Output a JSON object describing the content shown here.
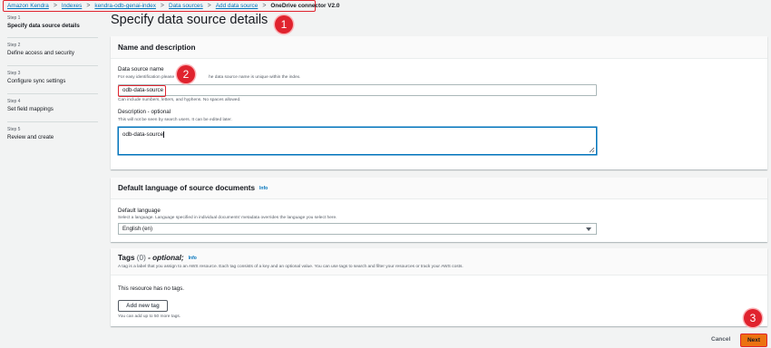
{
  "breadcrumb": {
    "items": [
      "Amazon Kendra",
      "Indexes",
      "kendra-odb-genai-index",
      "Data sources",
      "Add data source"
    ],
    "current": "OneDrive connector V2.0",
    "separator": ">"
  },
  "page_title": "Specify data source details",
  "steps": [
    {
      "num": "Step 1",
      "label": "Specify data source details",
      "active": true
    },
    {
      "num": "Step 2",
      "label": "Define access and security",
      "active": false
    },
    {
      "num": "Step 3",
      "label": "Configure sync settings",
      "active": false
    },
    {
      "num": "Step 4",
      "label": "Set field mappings",
      "active": false
    },
    {
      "num": "Step 5",
      "label": "Review and create",
      "active": false
    }
  ],
  "name_section": {
    "title": "Name and description",
    "name_label": "Data source name",
    "name_desc_start": "For easy identification please",
    "name_desc_end": "he data source name is unique within the index.",
    "name_value": "odb-data-source",
    "name_constraint": "Can include numbers, letters, and hyphens. No spaces allowed.",
    "desc_label": "Description - optional",
    "desc_help": "This will not be seen by search users. It can be edited later.",
    "desc_value": "odb-data-source"
  },
  "language_section": {
    "title": "Default language of source documents",
    "info": "Info",
    "label": "Default language",
    "desc": "Select a language. Language specified in individual documents' metadata overrides the language you select here.",
    "selected": "English (en)"
  },
  "tags_section": {
    "title_prefix": "Tags",
    "count": "(0)",
    "title_suffix": "- optional;",
    "info": "Info",
    "desc": "A tag is a label that you assign to an AWS resource. Each tag consists of a key and an optional value. You can use tags to search and filter your resources or track your AWS costs.",
    "empty": "This resource has no tags.",
    "add_button": "Add new tag",
    "limit": "You can add up to 50 more tags."
  },
  "footer": {
    "cancel": "Cancel",
    "next": "Next"
  },
  "annotations": [
    "1",
    "2",
    "3"
  ],
  "colors": {
    "highlight": "#e0232e",
    "link": "#0073bb",
    "primary_button": "#ec7211"
  }
}
